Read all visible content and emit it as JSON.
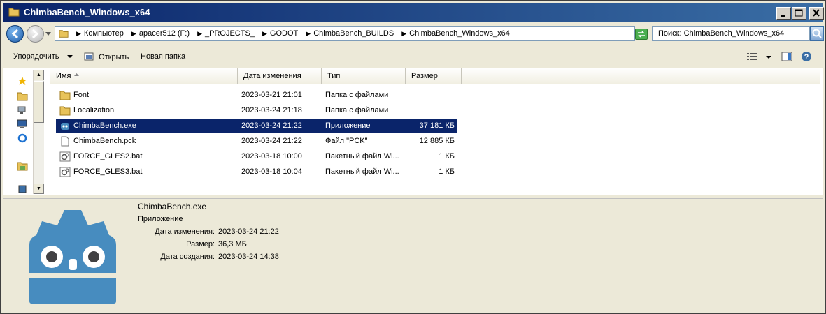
{
  "window": {
    "title": "ChimbaBench_Windows_x64"
  },
  "address": {
    "crumbs": [
      "Компьютер",
      "apacer512 (F:)",
      "_PROJECTS_",
      "GODOT",
      "ChimbaBench_BUILDS",
      "ChimbaBench_Windows_x64"
    ]
  },
  "search": {
    "placeholder": "Поиск: ChimbaBench_Windows_x64"
  },
  "toolbar": {
    "organize": "Упорядочить",
    "open": "Открыть",
    "new_folder": "Новая папка"
  },
  "columns": {
    "name": "Имя",
    "date": "Дата изменения",
    "type": "Тип",
    "size": "Размер"
  },
  "files": [
    {
      "name": "Font",
      "date": "2023-03-21 21:01",
      "type": "Папка с файлами",
      "size": "",
      "icon": "folder-icon"
    },
    {
      "name": "Localization",
      "date": "2023-03-24 21:18",
      "type": "Папка с файлами",
      "size": "",
      "icon": "folder-icon"
    },
    {
      "name": "ChimbaBench.exe",
      "date": "2023-03-24 21:22",
      "type": "Приложение",
      "size": "37 181 КБ",
      "icon": "godot-icon",
      "selected": true
    },
    {
      "name": "ChimbaBench.pck",
      "date": "2023-03-24 21:22",
      "type": "Файл \"PCK\"",
      "size": "12 885 КБ",
      "icon": "file-icon"
    },
    {
      "name": "FORCE_GLES2.bat",
      "date": "2023-03-18 10:00",
      "type": "Пакетный файл Wi...",
      "size": "1 КБ",
      "icon": "batch-file-icon"
    },
    {
      "name": "FORCE_GLES3.bat",
      "date": "2023-03-18 10:04",
      "type": "Пакетный файл Wi...",
      "size": "1 КБ",
      "icon": "batch-file-icon"
    }
  ],
  "details": {
    "name": "ChimbaBench.exe",
    "type": "Приложение",
    "modified_label": "Дата изменения:",
    "modified_value": "2023-03-24 21:22",
    "size_label": "Размер:",
    "size_value": "36,3 МБ",
    "created_label": "Дата создания:",
    "created_value": "2023-03-24 14:38"
  },
  "colors": {
    "selection": "#0a246a",
    "godot_blue": "#478cbf"
  }
}
